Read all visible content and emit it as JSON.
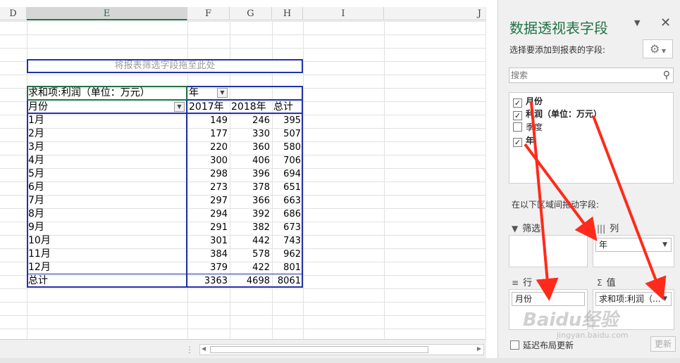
{
  "columns": [
    "D",
    "E",
    "F",
    "G",
    "H",
    "I",
    "J"
  ],
  "pivot": {
    "filter_drop_text": "将报表筛选字段拖至此处",
    "value_field_label": "求和项:利润（单位：万元）",
    "col_field_label": "年",
    "row_field_label": "月份",
    "col_labels": [
      "2017年",
      "2018年",
      "总计"
    ],
    "rows": [
      {
        "label": "1月",
        "values": [
          "149",
          "246",
          "395"
        ]
      },
      {
        "label": "2月",
        "values": [
          "177",
          "330",
          "507"
        ]
      },
      {
        "label": "3月",
        "values": [
          "220",
          "360",
          "580"
        ]
      },
      {
        "label": "4月",
        "values": [
          "300",
          "406",
          "706"
        ]
      },
      {
        "label": "5月",
        "values": [
          "298",
          "396",
          "694"
        ]
      },
      {
        "label": "6月",
        "values": [
          "273",
          "378",
          "651"
        ]
      },
      {
        "label": "7月",
        "values": [
          "297",
          "366",
          "663"
        ]
      },
      {
        "label": "8月",
        "values": [
          "294",
          "392",
          "686"
        ]
      },
      {
        "label": "9月",
        "values": [
          "291",
          "382",
          "673"
        ]
      },
      {
        "label": "10月",
        "values": [
          "301",
          "442",
          "743"
        ]
      },
      {
        "label": "11月",
        "values": [
          "384",
          "578",
          "962"
        ]
      },
      {
        "label": "12月",
        "values": [
          "379",
          "422",
          "801"
        ]
      }
    ],
    "total": {
      "label": "总计",
      "values": [
        "3363",
        "4698",
        "8061"
      ]
    }
  },
  "pane": {
    "title": "数据透视表字段",
    "subtitle": "选择要添加到报表的字段:",
    "search_placeholder": "搜索",
    "fields": [
      {
        "label": "月份",
        "checked": true
      },
      {
        "label": "利润（单位：万元）",
        "checked": true
      },
      {
        "label": "季度",
        "checked": false
      },
      {
        "label": "年",
        "checked": true
      }
    ],
    "areas_label": "在以下区域间拖动字段:",
    "areas": {
      "filter": {
        "title": "筛选"
      },
      "columns": {
        "title": "列",
        "chip": "年"
      },
      "rows": {
        "title": "行",
        "chip": "月份"
      },
      "values": {
        "title": "值",
        "chip": "求和项:利润（..."
      }
    },
    "defer_label": "延迟布局更新",
    "update_label": "更新"
  },
  "icons": {
    "pane_dropdown": "chevron-down-icon",
    "close": "close-icon",
    "gear": "gear-icon",
    "search": "search-icon",
    "filter_area": "funnel-icon",
    "columns_area": "columns-icon",
    "rows_area": "rows-icon",
    "values_area": "sigma-icon"
  },
  "colors": {
    "pivot_border": "#2232a8",
    "selection": "#217346",
    "annotation": "#ff2a1a",
    "pane_title": "#217346"
  },
  "watermark": {
    "text": "Baidu经验",
    "sub": "jingyan.baidu.com"
  }
}
